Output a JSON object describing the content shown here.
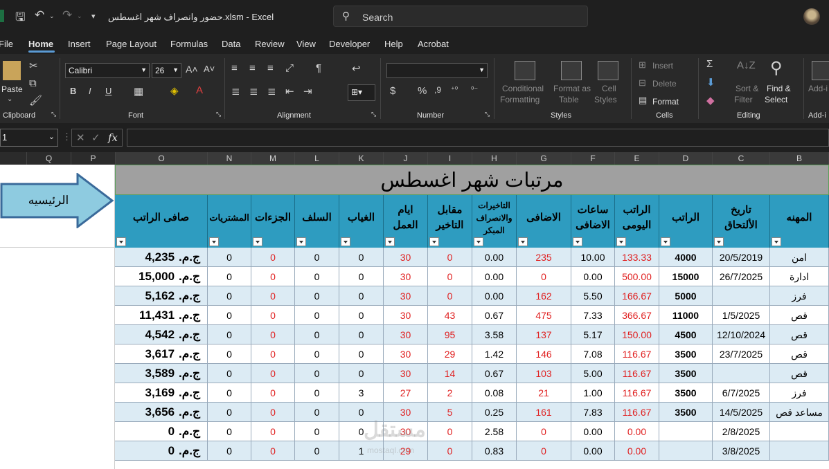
{
  "titlebar": {
    "file_title": "حضور وانصراف شهر اغسطس.xlsm  -  Excel",
    "search_placeholder": "Search"
  },
  "menu": [
    "File",
    "Home",
    "Insert",
    "Page Layout",
    "Formulas",
    "Data",
    "Review",
    "View",
    "Developer",
    "Help",
    "Acrobat"
  ],
  "ribbon": {
    "clipboard": {
      "paste": "Paste",
      "label": "Clipboard"
    },
    "font": {
      "name": "Calibri",
      "size": "26",
      "label": "Font"
    },
    "alignment": {
      "label": "Alignment"
    },
    "number": {
      "label": "Number",
      "currency": "$",
      "percent": "%"
    },
    "styles": {
      "conditional_1": "Conditional",
      "conditional_2": "Formatting",
      "format_as_1": "Format as",
      "format_as_2": "Table",
      "cell_1": "Cell",
      "cell_2": "Styles",
      "label": "Styles"
    },
    "cells": {
      "insert": "Insert",
      "delete": "Delete",
      "format": "Format",
      "label": "Cells"
    },
    "editing": {
      "sort_1": "Sort &",
      "sort_2": "Filter",
      "find_1": "Find &",
      "find_2": "Select",
      "label": "Editing"
    },
    "addins": {
      "label_1": "Add-i",
      "label_2": "Add-i"
    }
  },
  "formula_bar": {
    "name_box": "1",
    "fx": "fx"
  },
  "columns": [
    "Q",
    "P",
    "O",
    "N",
    "M",
    "L",
    "K",
    "J",
    "I",
    "H",
    "G",
    "F",
    "E",
    "D",
    "C",
    "B"
  ],
  "sheet": {
    "banner": "مرتبات شهر اغسطس",
    "home_button": "الرئيسيه",
    "headers": {
      "net": "صافى الراتب",
      "purchases": "المشتريات",
      "penalties": "الجزءات",
      "advances": "السلف",
      "absence": "الغياب",
      "workdays": "ايام العمل",
      "late_pay": "مقابل التاخير",
      "late_hours": "التاخيرات والانصراف المبكر",
      "extra": "الاضافى",
      "extra_hours": "ساعات الاضافى",
      "daily": "الراتب اليومى",
      "salary": "الراتب",
      "join_date": "تاريخ الألتحاق",
      "job": "المهنه"
    },
    "currency": "ج.م.",
    "rows": [
      {
        "net": "4,235",
        "purchases": "0",
        "penalties": "0",
        "advances": "0",
        "absence": "0",
        "workdays": "30",
        "late_pay": "0",
        "late_hours": "0.00",
        "extra": "235",
        "extra_hours": "10.00",
        "daily": "133.33",
        "salary": "4000",
        "join_date": "20/5/2019",
        "job": "امن"
      },
      {
        "net": "15,000",
        "purchases": "0",
        "penalties": "0",
        "advances": "0",
        "absence": "0",
        "workdays": "30",
        "late_pay": "0",
        "late_hours": "0.00",
        "extra": "0",
        "extra_hours": "0.00",
        "daily": "500.00",
        "salary": "15000",
        "join_date": "26/7/2025",
        "job": "ادارة"
      },
      {
        "net": "5,162",
        "purchases": "0",
        "penalties": "0",
        "advances": "0",
        "absence": "0",
        "workdays": "30",
        "late_pay": "0",
        "late_hours": "0.00",
        "extra": "162",
        "extra_hours": "5.50",
        "daily": "166.67",
        "salary": "5000",
        "join_date": "",
        "job": "فرز"
      },
      {
        "net": "11,431",
        "purchases": "0",
        "penalties": "0",
        "advances": "0",
        "absence": "0",
        "workdays": "30",
        "late_pay": "43",
        "late_hours": "0.67",
        "extra": "475",
        "extra_hours": "7.33",
        "daily": "366.67",
        "salary": "11000",
        "join_date": "1/5/2025",
        "job": "قص"
      },
      {
        "net": "4,542",
        "purchases": "0",
        "penalties": "0",
        "advances": "0",
        "absence": "0",
        "workdays": "30",
        "late_pay": "95",
        "late_hours": "3.58",
        "extra": "137",
        "extra_hours": "5.17",
        "daily": "150.00",
        "salary": "4500",
        "join_date": "12/10/2024",
        "job": "قص"
      },
      {
        "net": "3,617",
        "purchases": "0",
        "penalties": "0",
        "advances": "0",
        "absence": "0",
        "workdays": "30",
        "late_pay": "29",
        "late_hours": "1.42",
        "extra": "146",
        "extra_hours": "7.08",
        "daily": "116.67",
        "salary": "3500",
        "join_date": "23/7/2025",
        "job": "قص"
      },
      {
        "net": "3,589",
        "purchases": "0",
        "penalties": "0",
        "advances": "0",
        "absence": "0",
        "workdays": "30",
        "late_pay": "14",
        "late_hours": "0.67",
        "extra": "103",
        "extra_hours": "5.00",
        "daily": "116.67",
        "salary": "3500",
        "join_date": "",
        "job": "قص"
      },
      {
        "net": "3,169",
        "purchases": "0",
        "penalties": "0",
        "advances": "0",
        "absence": "3",
        "workdays": "27",
        "late_pay": "2",
        "late_hours": "0.08",
        "extra": "21",
        "extra_hours": "1.00",
        "daily": "116.67",
        "salary": "3500",
        "join_date": "6/7/2025",
        "job": "فرز"
      },
      {
        "net": "3,656",
        "purchases": "0",
        "penalties": "0",
        "advances": "0",
        "absence": "0",
        "workdays": "30",
        "late_pay": "5",
        "late_hours": "0.25",
        "extra": "161",
        "extra_hours": "7.83",
        "daily": "116.67",
        "salary": "3500",
        "join_date": "14/5/2025",
        "job": "مساعد قص"
      },
      {
        "net": "0",
        "purchases": "0",
        "penalties": "0",
        "advances": "0",
        "absence": "0",
        "workdays": "30",
        "late_pay": "0",
        "late_hours": "2.58",
        "extra": "0",
        "extra_hours": "0.00",
        "daily": "0.00",
        "salary": "",
        "join_date": "2/8/2025",
        "job": ""
      },
      {
        "net": "0",
        "purchases": "0",
        "penalties": "0",
        "advances": "0",
        "absence": "1",
        "workdays": "29",
        "late_pay": "0",
        "late_hours": "0.83",
        "extra": "0",
        "extra_hours": "0.00",
        "daily": "0.00",
        "salary": "",
        "join_date": "3/8/2025",
        "job": ""
      }
    ]
  },
  "watermark": {
    "main": "مستقل",
    "sub": "mostaql.com"
  },
  "colors": {
    "header_bg": "#2e9cc0",
    "banner_bg": "#a0a0a0",
    "row_alt": "#dcebf4",
    "red_text": "#e02020"
  }
}
